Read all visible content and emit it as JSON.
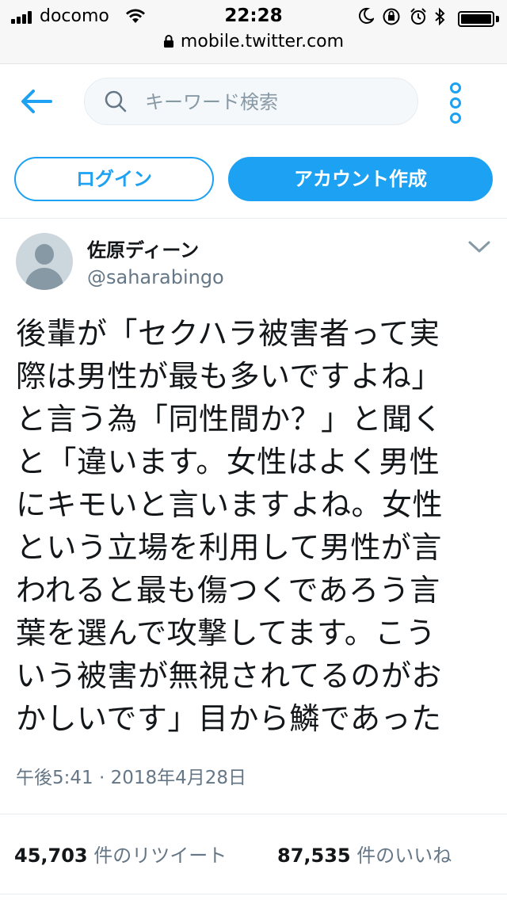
{
  "status_bar": {
    "carrier": "docomo",
    "time": "22:28",
    "url": "mobile.twitter.com"
  },
  "header": {
    "search_placeholder": "キーワード検索",
    "login_label": "ログイン",
    "signup_label": "アカウント作成"
  },
  "tweet": {
    "display_name": "佐原ディーン",
    "handle": "@saharabingo",
    "text_lines": [
      "後輩が「セクハラ被害者って実",
      "際は男性が最も多いですよね」",
      "と言う為「同性間か？」と聞く",
      "と「違います。女性はよく男性",
      "にキモいと言いますよね。女性",
      "という立場を利用して男性が言",
      "われると最も傷つくであろう言",
      "葉を選んで攻撃してます。こう",
      "いう被害が無視されてるのがお",
      "かしいです」目から鱗であった"
    ],
    "timestamp": "午後5:41 · 2018年4月28日",
    "retweets_count": "45,703",
    "retweets_label": "件のリツイート",
    "likes_count": "87,535",
    "likes_label": "件のいいね"
  },
  "colors": {
    "accent": "#1da1f2",
    "text": "#14171a",
    "secondary": "#657786"
  }
}
